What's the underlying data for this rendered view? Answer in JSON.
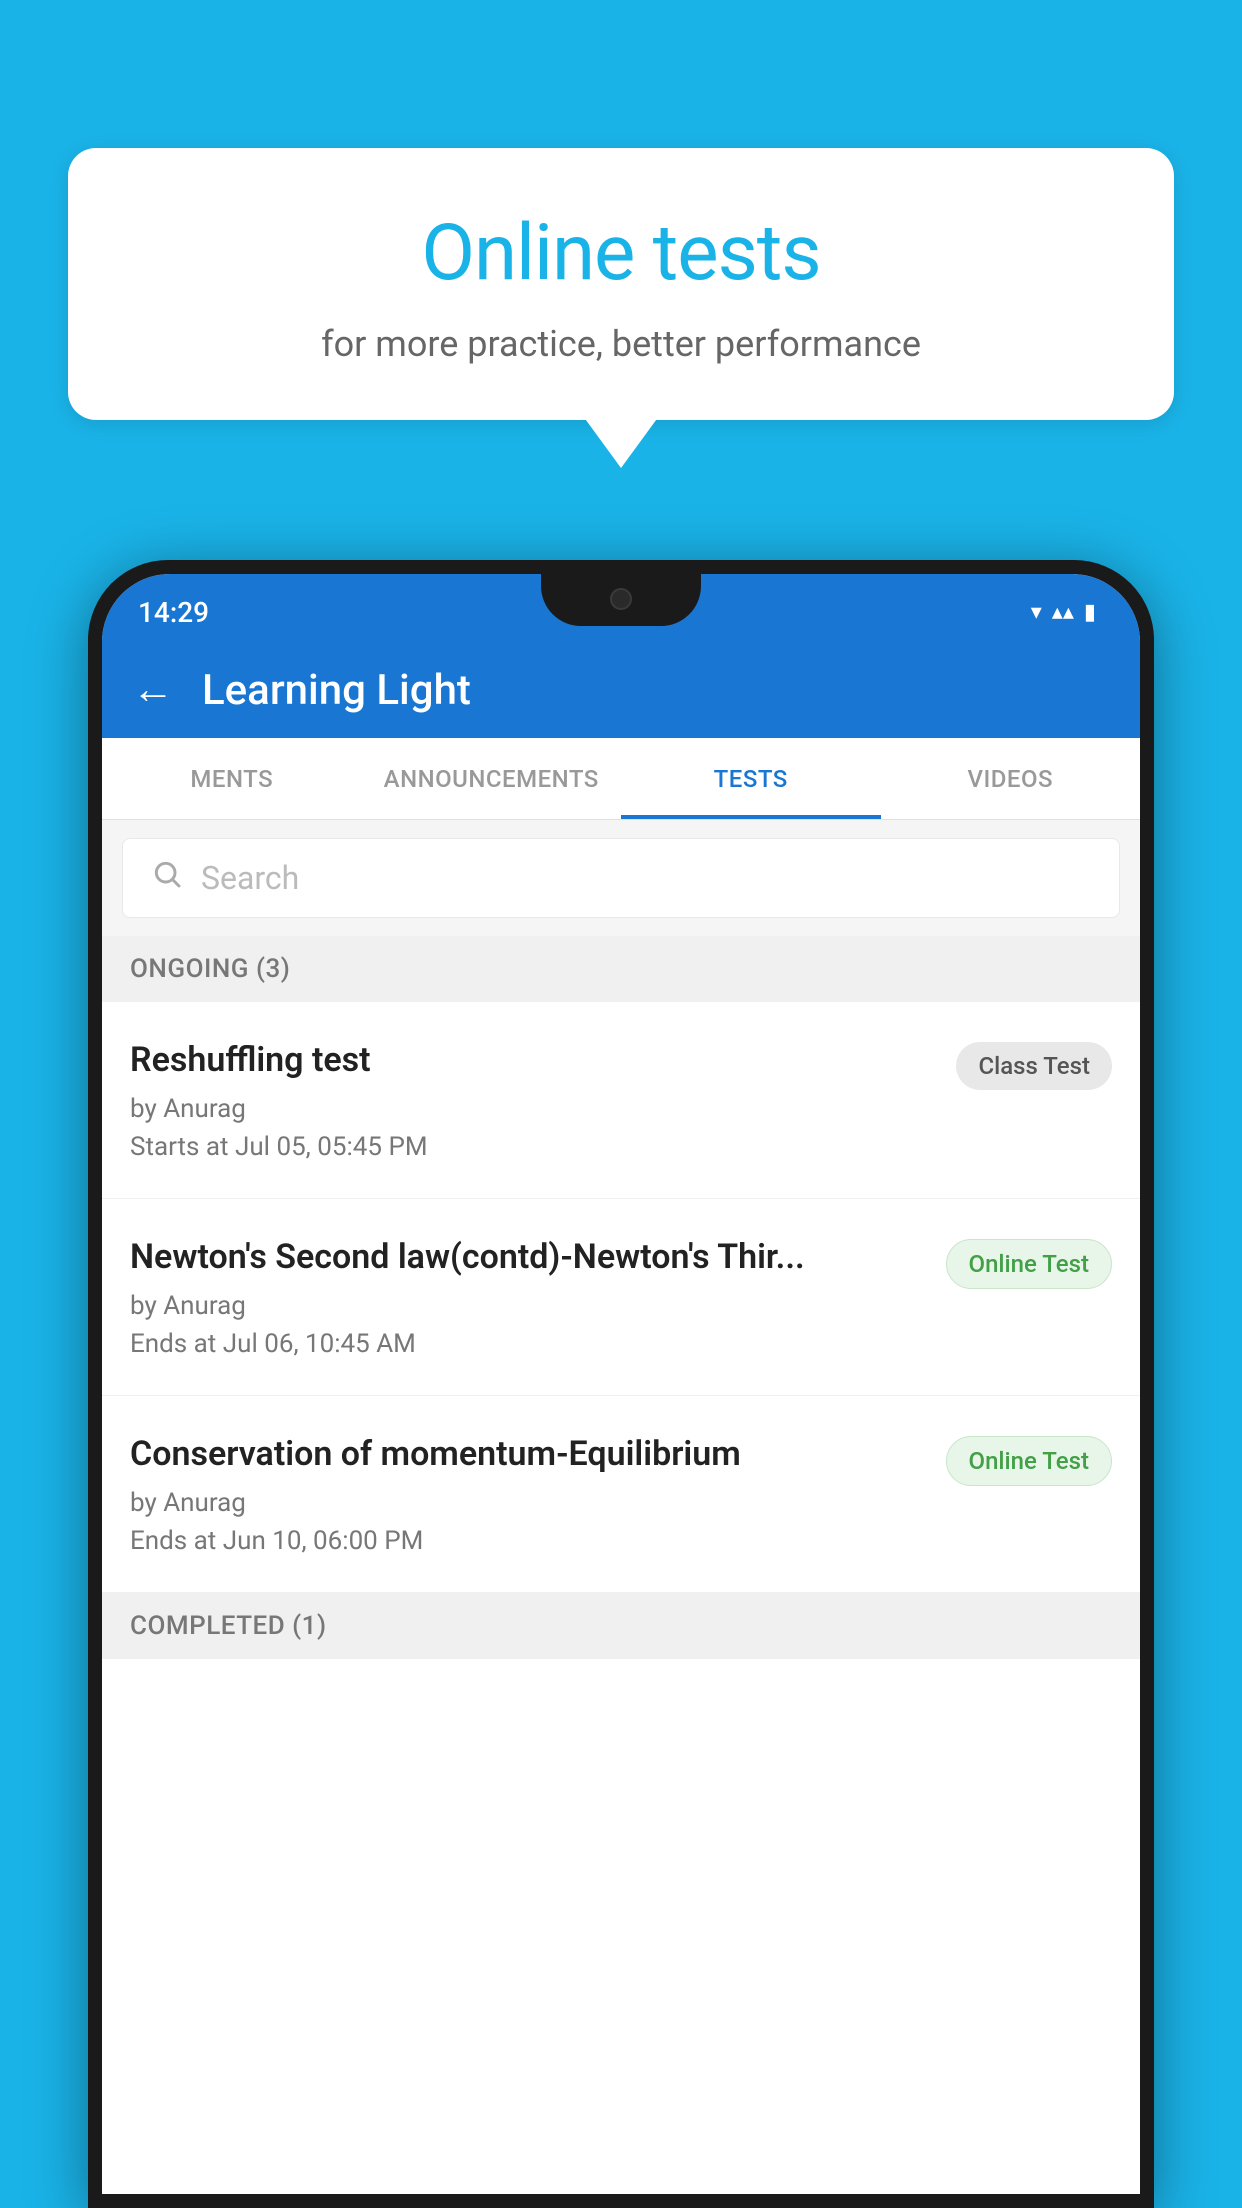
{
  "background_color": "#1ab3e8",
  "speech_bubble": {
    "title": "Online tests",
    "subtitle": "for more practice, better performance"
  },
  "phone": {
    "status_bar": {
      "time": "14:29",
      "icons": [
        "wifi",
        "signal",
        "battery"
      ]
    },
    "app_bar": {
      "title": "Learning Light",
      "back_label": "←"
    },
    "tabs": [
      {
        "label": "MENTS",
        "active": false
      },
      {
        "label": "ANNOUNCEMENTS",
        "active": false
      },
      {
        "label": "TESTS",
        "active": true
      },
      {
        "label": "VIDEOS",
        "active": false
      }
    ],
    "search": {
      "placeholder": "Search"
    },
    "section_ongoing": {
      "label": "ONGOING (3)"
    },
    "test_items": [
      {
        "title": "Reshuffling test",
        "author": "by Anurag",
        "date": "Starts at  Jul 05, 05:45 PM",
        "badge": "Class Test",
        "badge_type": "class"
      },
      {
        "title": "Newton's Second law(contd)-Newton's Thir...",
        "author": "by Anurag",
        "date": "Ends at  Jul 06, 10:45 AM",
        "badge": "Online Test",
        "badge_type": "online"
      },
      {
        "title": "Conservation of momentum-Equilibrium",
        "author": "by Anurag",
        "date": "Ends at  Jun 10, 06:00 PM",
        "badge": "Online Test",
        "badge_type": "online"
      }
    ],
    "section_completed": {
      "label": "COMPLETED (1)"
    }
  }
}
